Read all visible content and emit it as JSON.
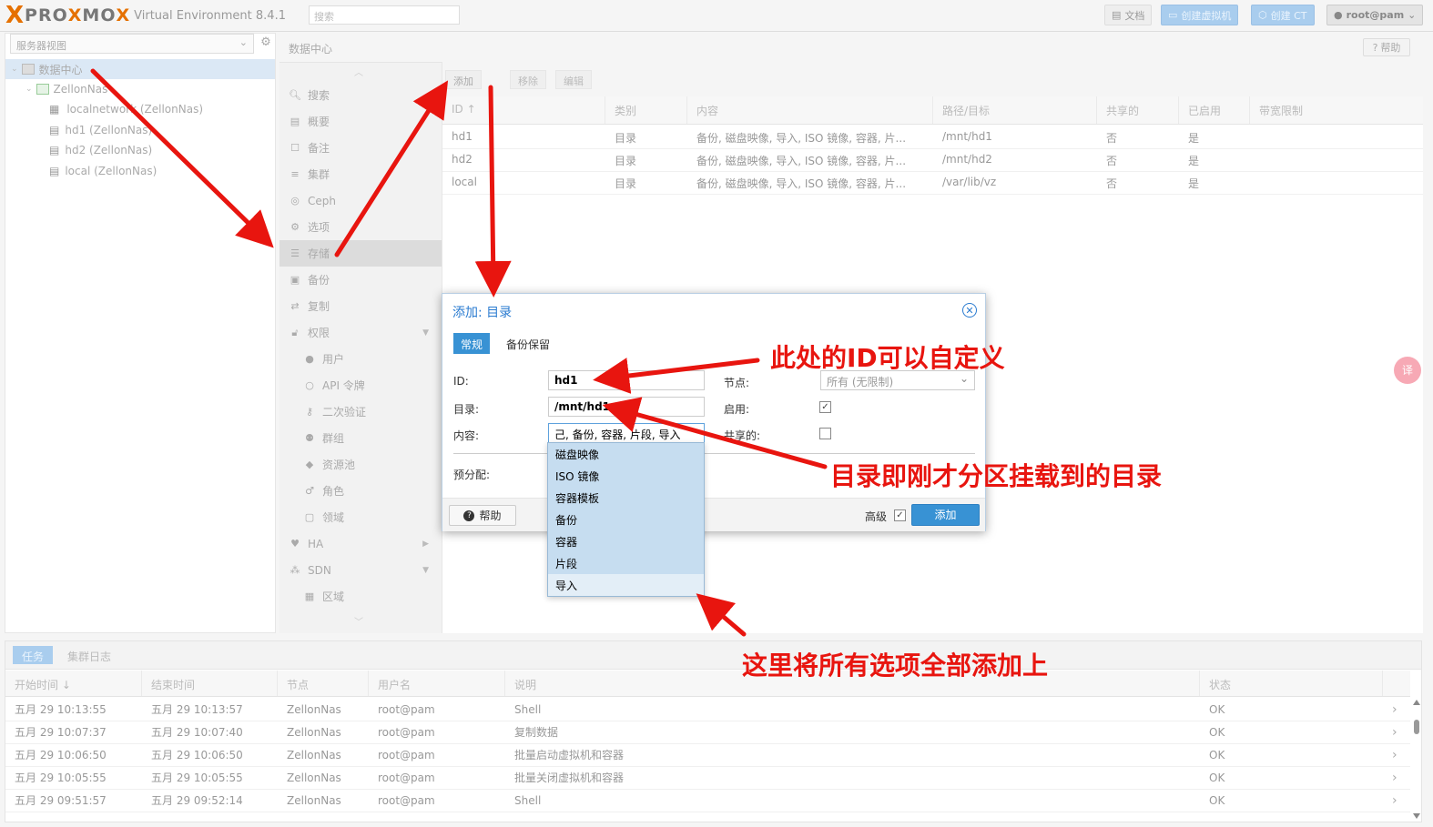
{
  "topbar": {
    "logo_x": "X",
    "logo_word_a": "PRO",
    "logo_word_x": "X",
    "logo_word_b": "MO",
    "logo_word_x2": "X",
    "version": "Virtual Environment 8.4.1",
    "search_placeholder": "搜索",
    "docs_label": "文档",
    "create_vm_label": "创建虚拟机",
    "create_ct_label": "创建 CT",
    "user_label": "root@pam"
  },
  "left_panel": {
    "view_select": "服务器视图",
    "tree": [
      {
        "label": "数据中心",
        "selected": true
      },
      {
        "label": "ZellonNas"
      },
      {
        "label": "localnetwork (ZellonNas)"
      },
      {
        "label": "hd1 (ZellonNas)"
      },
      {
        "label": "hd2 (ZellonNas)"
      },
      {
        "label": "local (ZellonNas)"
      }
    ]
  },
  "breadcrumb": "数据中心",
  "help_label": "帮助",
  "nav": {
    "items": [
      {
        "label": "搜索",
        "icon": "search-icon"
      },
      {
        "label": "概要",
        "icon": "book-icon"
      },
      {
        "label": "备注",
        "icon": "note-icon"
      },
      {
        "label": "集群",
        "icon": "server-icon"
      },
      {
        "label": "Ceph",
        "icon": "ceph-icon"
      },
      {
        "label": "选项",
        "icon": "gear-icon"
      },
      {
        "label": "存储",
        "icon": "database-icon",
        "selected": true
      },
      {
        "label": "备份",
        "icon": "floppy-icon"
      },
      {
        "label": "复制",
        "icon": "retweet-icon"
      },
      {
        "label": "权限",
        "icon": "unlock-icon"
      },
      {
        "label": "用户",
        "icon": "user-icon"
      },
      {
        "label": "API 令牌",
        "icon": "user-outline-icon"
      },
      {
        "label": "二次验证",
        "icon": "key-icon"
      },
      {
        "label": "群组",
        "icon": "users-icon"
      },
      {
        "label": "资源池",
        "icon": "tags-icon"
      },
      {
        "label": "角色",
        "icon": "male-icon"
      },
      {
        "label": "领域",
        "icon": "address-book-icon"
      },
      {
        "label": "HA",
        "icon": "heartbeat-icon"
      },
      {
        "label": "SDN",
        "icon": "sdn-icon"
      },
      {
        "label": "区域",
        "icon": "grid-icon"
      }
    ]
  },
  "storage": {
    "toolbar": {
      "add": "添加",
      "remove": "移除",
      "edit": "编辑"
    },
    "columns": [
      "ID ↑",
      "类别",
      "内容",
      "路径/目标",
      "共享的",
      "已启用",
      "带宽限制"
    ],
    "rows": [
      {
        "id": "hd1",
        "type": "目录",
        "content": "备份, 磁盘映像, 导入, ISO 镜像, 容器, 片...",
        "path": "/mnt/hd1",
        "shared": "否",
        "enabled": "是"
      },
      {
        "id": "hd2",
        "type": "目录",
        "content": "备份, 磁盘映像, 导入, ISO 镜像, 容器, 片...",
        "path": "/mnt/hd2",
        "shared": "否",
        "enabled": "是"
      },
      {
        "id": "local",
        "type": "目录",
        "content": "备份, 磁盘映像, 导入, ISO 镜像, 容器, 片...",
        "path": "/var/lib/vz",
        "shared": "否",
        "enabled": "是"
      }
    ]
  },
  "dialog": {
    "title": "添加: 目录",
    "tabs": [
      "常规",
      "备份保留"
    ],
    "id_label": "ID:",
    "id_value": "hd1",
    "dir_label": "目录:",
    "dir_value": "/mnt/hd1",
    "content_label": "内容:",
    "content_value": "己, 备份, 容器, 片段, 导入",
    "node_label": "节点:",
    "node_value": "所有 (无限制)",
    "enable_label": "启用:",
    "shared_label": "共享的:",
    "prealloc_label": "预分配:",
    "help_label": "帮助",
    "advanced_label": "高级",
    "add_label": "添加",
    "dropdown": [
      "磁盘映像",
      "ISO 镜像",
      "容器模板",
      "备份",
      "容器",
      "片段",
      "导入"
    ]
  },
  "tasks": {
    "tabs": [
      "任务",
      "集群日志"
    ],
    "columns": [
      "开始时间 ↓",
      "结束时间",
      "节点",
      "用户名",
      "说明",
      "状态"
    ],
    "rows": [
      {
        "start": "五月 29 10:13:55",
        "end": "五月 29 10:13:57",
        "node": "ZellonNas",
        "user": "root@pam",
        "desc": "Shell",
        "status": "OK"
      },
      {
        "start": "五月 29 10:07:37",
        "end": "五月 29 10:07:40",
        "node": "ZellonNas",
        "user": "root@pam",
        "desc": "复制数据",
        "status": "OK"
      },
      {
        "start": "五月 29 10:06:50",
        "end": "五月 29 10:06:50",
        "node": "ZellonNas",
        "user": "root@pam",
        "desc": "批量启动虚拟机和容器",
        "status": "OK"
      },
      {
        "start": "五月 29 10:05:55",
        "end": "五月 29 10:05:55",
        "node": "ZellonNas",
        "user": "root@pam",
        "desc": "批量关闭虚拟机和容器",
        "status": "OK"
      },
      {
        "start": "五月 29 09:51:57",
        "end": "五月 29 09:52:14",
        "node": "ZellonNas",
        "user": "root@pam",
        "desc": "Shell",
        "status": "OK"
      }
    ]
  },
  "annotations": {
    "id_note": "此处的ID可以自定义",
    "dir_note": "目录即刚才分区挂载到的目录",
    "all_note": "这里将所有选项全部添加上"
  },
  "colors": {
    "accent": "#3892d4",
    "annotation": "#e8150f",
    "logo_orange": "#e57000"
  }
}
